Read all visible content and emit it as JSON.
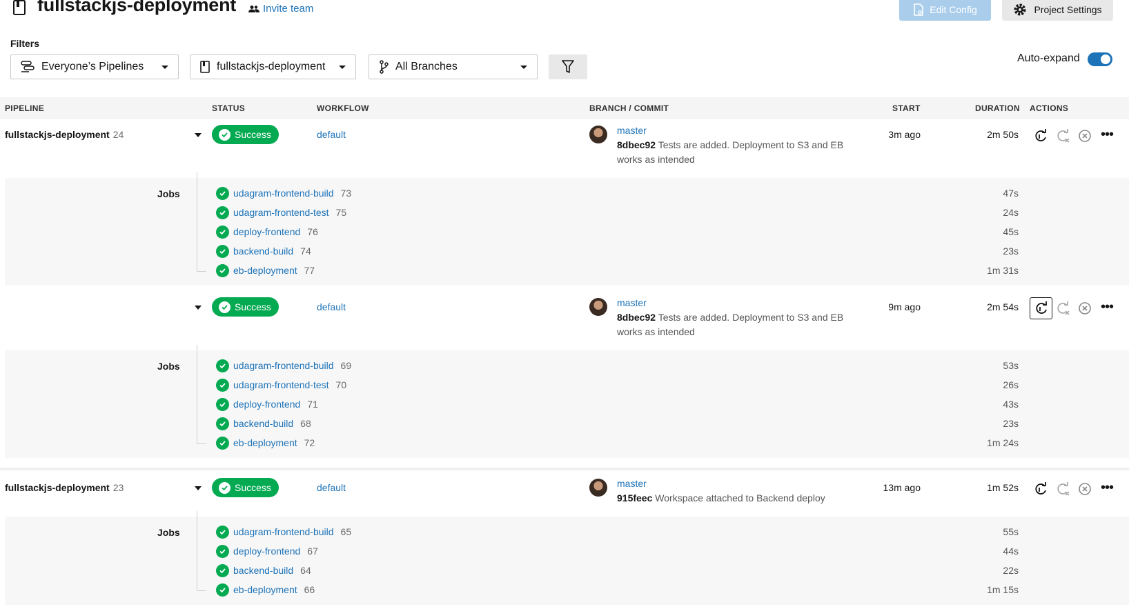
{
  "header": {
    "project_title": "fullstackjs-deployment",
    "invite_label": "Invite team",
    "edit_config_label": "Edit Config",
    "project_settings_label": "Project Settings"
  },
  "filters": {
    "label": "Filters",
    "pipelines_dropdown": "Everyone’s Pipelines",
    "project_dropdown": "fullstackjs-deployment",
    "branches_dropdown": "All Branches",
    "auto_expand_label": "Auto-expand",
    "auto_expand_on": true
  },
  "table": {
    "columns": [
      "PIPELINE",
      "STATUS",
      "WORKFLOW",
      "BRANCH / COMMIT",
      "START",
      "DURATION",
      "ACTIONS"
    ],
    "jobs_label": "Jobs"
  },
  "pipelines": [
    {
      "name": "fullstackjs-deployment",
      "number": "24",
      "workflows": [
        {
          "status": "Success",
          "workflow": "default",
          "branch": "master",
          "commit_hash": "8dbec92",
          "commit_msg": "Tests are added. Deployment to S3 and EB works as intended",
          "start": "3m ago",
          "duration": "2m 50s",
          "jobs": [
            {
              "name": "udagram-frontend-build",
              "num": "73",
              "dur": "47s"
            },
            {
              "name": "udagram-frontend-test",
              "num": "75",
              "dur": "24s"
            },
            {
              "name": "deploy-frontend",
              "num": "76",
              "dur": "45s"
            },
            {
              "name": "backend-build",
              "num": "74",
              "dur": "23s"
            },
            {
              "name": "eb-deployment",
              "num": "77",
              "dur": "1m 31s"
            }
          ]
        },
        {
          "status": "Success",
          "workflow": "default",
          "branch": "master",
          "commit_hash": "8dbec92",
          "commit_msg": "Tests are added. Deployment to S3 and EB works as intended",
          "start": "9m ago",
          "duration": "2m 54s",
          "jobs": [
            {
              "name": "udagram-frontend-build",
              "num": "69",
              "dur": "53s"
            },
            {
              "name": "udagram-frontend-test",
              "num": "70",
              "dur": "26s"
            },
            {
              "name": "deploy-frontend",
              "num": "71",
              "dur": "43s"
            },
            {
              "name": "backend-build",
              "num": "68",
              "dur": "23s"
            },
            {
              "name": "eb-deployment",
              "num": "72",
              "dur": "1m 24s"
            }
          ]
        }
      ]
    },
    {
      "name": "fullstackjs-deployment",
      "number": "23",
      "workflows": [
        {
          "status": "Success",
          "workflow": "default",
          "branch": "master",
          "commit_hash": "915feec",
          "commit_msg": "Workspace attached to Backend deploy",
          "start": "13m ago",
          "duration": "1m 52s",
          "jobs": [
            {
              "name": "udagram-frontend-build",
              "num": "65",
              "dur": "55s"
            },
            {
              "name": "deploy-frontend",
              "num": "67",
              "dur": "44s"
            },
            {
              "name": "backend-build",
              "num": "64",
              "dur": "22s"
            },
            {
              "name": "eb-deployment",
              "num": "66",
              "dur": "1m 15s"
            }
          ]
        }
      ]
    }
  ],
  "colors": {
    "accent": "#1d73b8",
    "success": "#04aa51",
    "edit_config_bg": "#a9cdeb"
  }
}
